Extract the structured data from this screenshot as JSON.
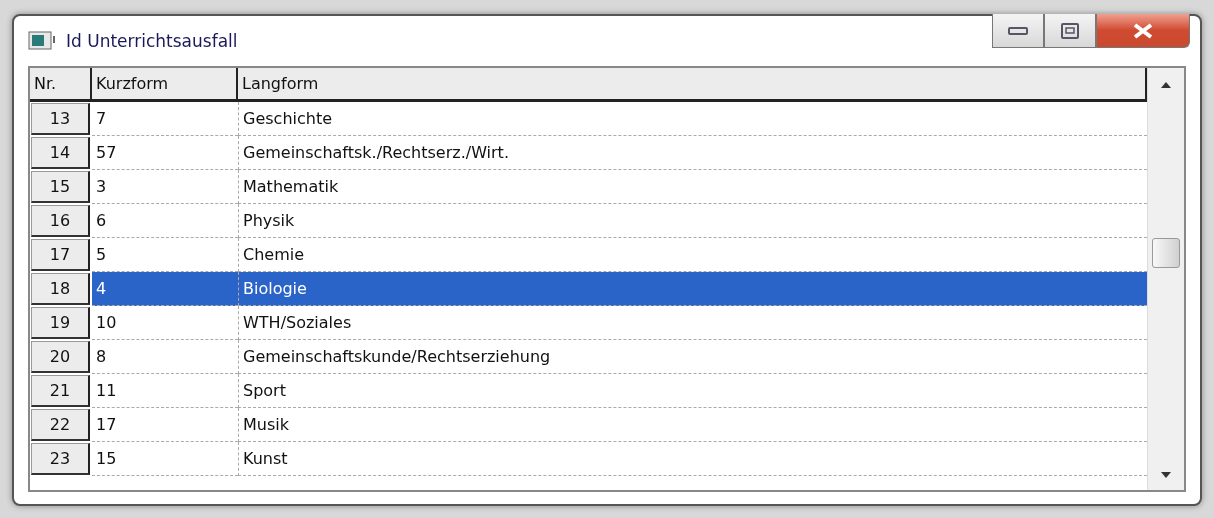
{
  "window": {
    "title": "Id Unterrichtsausfall"
  },
  "table": {
    "columns": [
      "Nr.",
      "Kurzform",
      "Langform"
    ],
    "rows": [
      {
        "nr": "13",
        "kurzform": "7",
        "langform": "Geschichte",
        "selected": false
      },
      {
        "nr": "14",
        "kurzform": "57",
        "langform": "Gemeinschaftsk./Rechtserz./Wirt.",
        "selected": false
      },
      {
        "nr": "15",
        "kurzform": "3",
        "langform": "Mathematik",
        "selected": false
      },
      {
        "nr": "16",
        "kurzform": "6",
        "langform": "Physik",
        "selected": false
      },
      {
        "nr": "17",
        "kurzform": "5",
        "langform": "Chemie",
        "selected": false
      },
      {
        "nr": "18",
        "kurzform": "4",
        "langform": "Biologie",
        "selected": true
      },
      {
        "nr": "19",
        "kurzform": "10",
        "langform": "WTH/Soziales",
        "selected": false
      },
      {
        "nr": "20",
        "kurzform": "8",
        "langform": "Gemeinschaftskunde/Rechtserziehung",
        "selected": false
      },
      {
        "nr": "21",
        "kurzform": "11",
        "langform": "Sport",
        "selected": false
      },
      {
        "nr": "22",
        "kurzform": "17",
        "langform": "Musik",
        "selected": false
      },
      {
        "nr": "23",
        "kurzform": "15",
        "langform": "Kunst",
        "selected": false
      }
    ]
  }
}
